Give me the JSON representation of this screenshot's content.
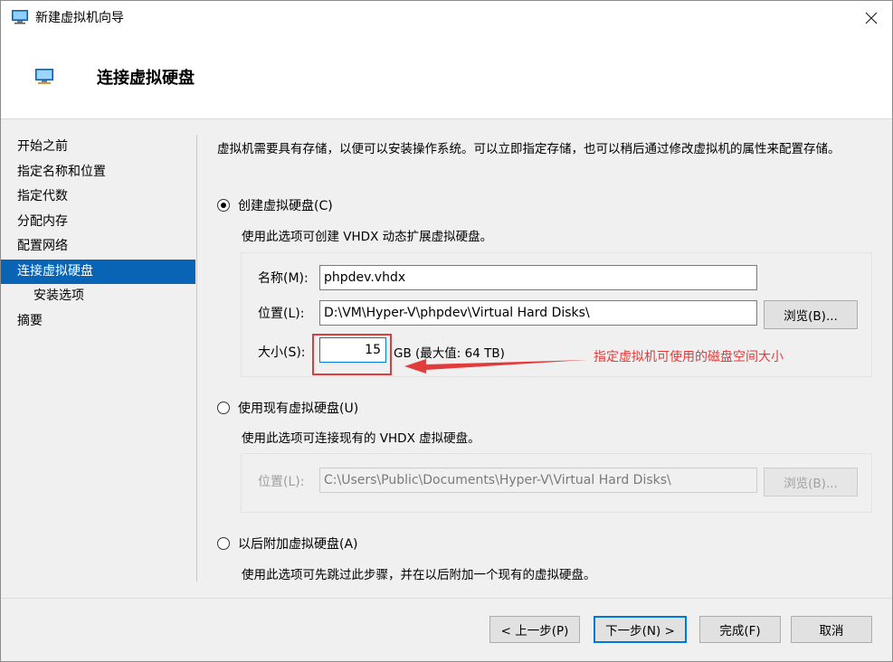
{
  "window": {
    "title": "新建虚拟机向导",
    "page_title": "连接虚拟硬盘"
  },
  "nav": {
    "items": [
      {
        "label": "开始之前"
      },
      {
        "label": "指定名称和位置"
      },
      {
        "label": "指定代数"
      },
      {
        "label": "分配内存"
      },
      {
        "label": "配置网络"
      },
      {
        "label": "连接虚拟硬盘"
      },
      {
        "label": "安装选项"
      },
      {
        "label": "摘要"
      }
    ]
  },
  "main": {
    "description": "虚拟机需要具有存储，以便可以安装操作系统。可以立即指定存储，也可以稍后通过修改虚拟机的属性来配置存储。",
    "option_create": {
      "label": "创建虚拟硬盘(C)",
      "desc": "使用此选项可创建 VHDX 动态扩展虚拟硬盘。",
      "name_label": "名称(M):",
      "name_value": "phpdev.vhdx",
      "location_label": "位置(L):",
      "location_value": "D:\\VM\\Hyper-V\\phpdev\\Virtual Hard Disks\\",
      "browse_label": "浏览(B)...",
      "size_label": "大小(S):",
      "size_value": "15",
      "size_unit": "GB (最大值: 64 TB)"
    },
    "option_existing": {
      "label": "使用现有虚拟硬盘(U)",
      "desc": "使用此选项可连接现有的 VHDX 虚拟硬盘。",
      "location_label": "位置(L):",
      "location_value": "C:\\Users\\Public\\Documents\\Hyper-V\\Virtual Hard Disks\\",
      "browse_label": "浏览(B)..."
    },
    "option_later": {
      "label": "以后附加虚拟硬盘(A)",
      "desc": "使用此选项可先跳过此步骤，并在以后附加一个现有的虚拟硬盘。"
    },
    "annotation": "指定虚拟机可使用的磁盘空间大小"
  },
  "footer": {
    "prev": "< 上一步(P)",
    "next": "下一步(N) >",
    "finish": "完成(F)",
    "cancel": "取消"
  },
  "colors": {
    "accent": "#0a64b5",
    "annotation": "#e23b3b"
  }
}
